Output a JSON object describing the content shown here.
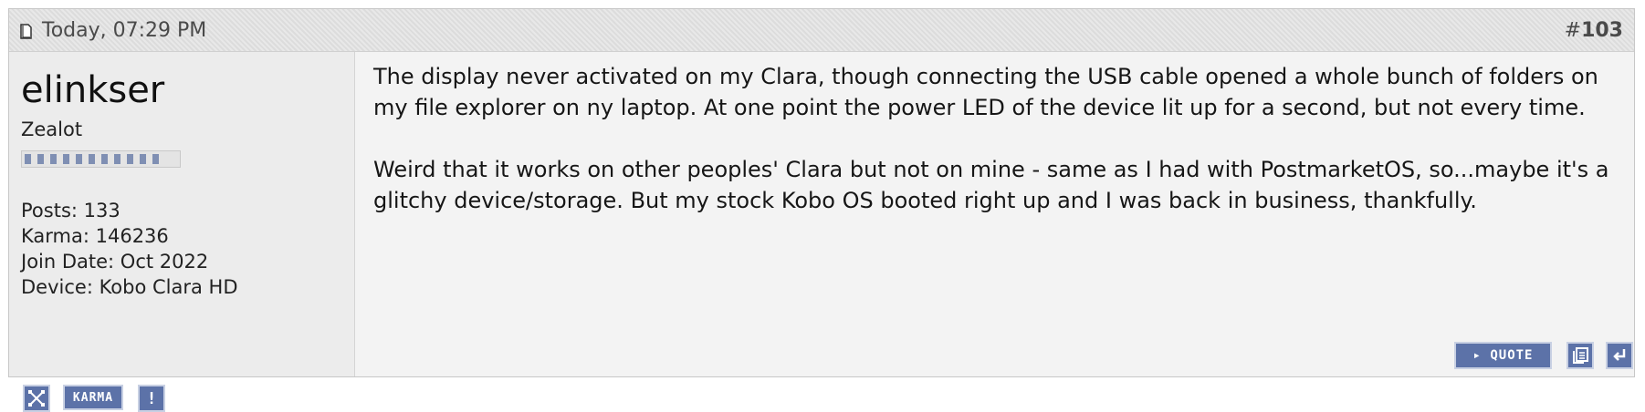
{
  "post": {
    "date": "Today, 07:29 PM",
    "number_prefix": "#",
    "number": "103"
  },
  "user": {
    "name": "elinkser",
    "title": "Zealot",
    "reputation_pips": 11,
    "stats": {
      "posts": "Posts: 133",
      "karma": "Karma: 146236",
      "join_date": "Join Date: Oct 2022",
      "device": "Device: Kobo Clara HD"
    }
  },
  "message": {
    "paragraphs": [
      "The display never activated on my Clara, though connecting the USB cable opened a whole bunch of folders on my file explorer on ny laptop. At one point the power LED of the device lit up for a second, but not every time.",
      "Weird that it works on other peoples' Clara but not on mine - same as I had with PostmarketOS, so...maybe it's a glitchy device/storage. But my stock Kobo OS booted right up and I was back in business, thankfully."
    ]
  },
  "buttons": {
    "karma_label": "KARMA",
    "alert_label": "!",
    "quote_label": "▸ QUOTE"
  },
  "icons": {
    "post_icon": "document-icon",
    "report_icon": "crossed-arrows-icon",
    "multiquote_icon": "multiquote-icon",
    "reply_icon": "reply-arrow-icon"
  },
  "colors": {
    "button_blue": "#5c72a8",
    "header_bg": "#dcdcdc",
    "message_bg": "#f3f3f3"
  }
}
